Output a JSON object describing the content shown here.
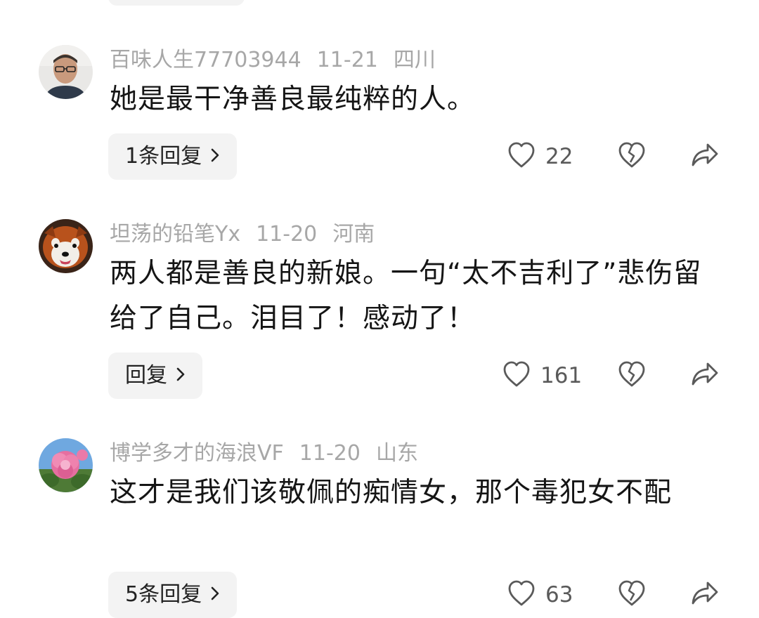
{
  "comments": [
    {
      "username": "百味人生77703944",
      "date": "11-21",
      "location": "四川",
      "text": "她是最干净善良最纯粹的人。",
      "reply_label": "1条回复",
      "likes": "22"
    },
    {
      "username": "坦荡的铅笔Yx",
      "date": "11-20",
      "location": "河南",
      "text": "两人都是善良的新娘。一句“太不吉利了”悲伤留给了自己。泪目了！感动了！",
      "reply_label": "回复",
      "likes": "161"
    },
    {
      "username": "博学多才的海浪VF",
      "date": "11-20",
      "location": "山东",
      "text": "这才是我们该敬佩的痴情女，那个毒犯女不配",
      "reply_label": "5条回复",
      "likes": "63"
    }
  ],
  "icons": {
    "like": "heart-outline-icon",
    "dislike": "broken-heart-icon",
    "share": "share-arrow-icon",
    "reply_chevron": "chevron-right-icon"
  }
}
